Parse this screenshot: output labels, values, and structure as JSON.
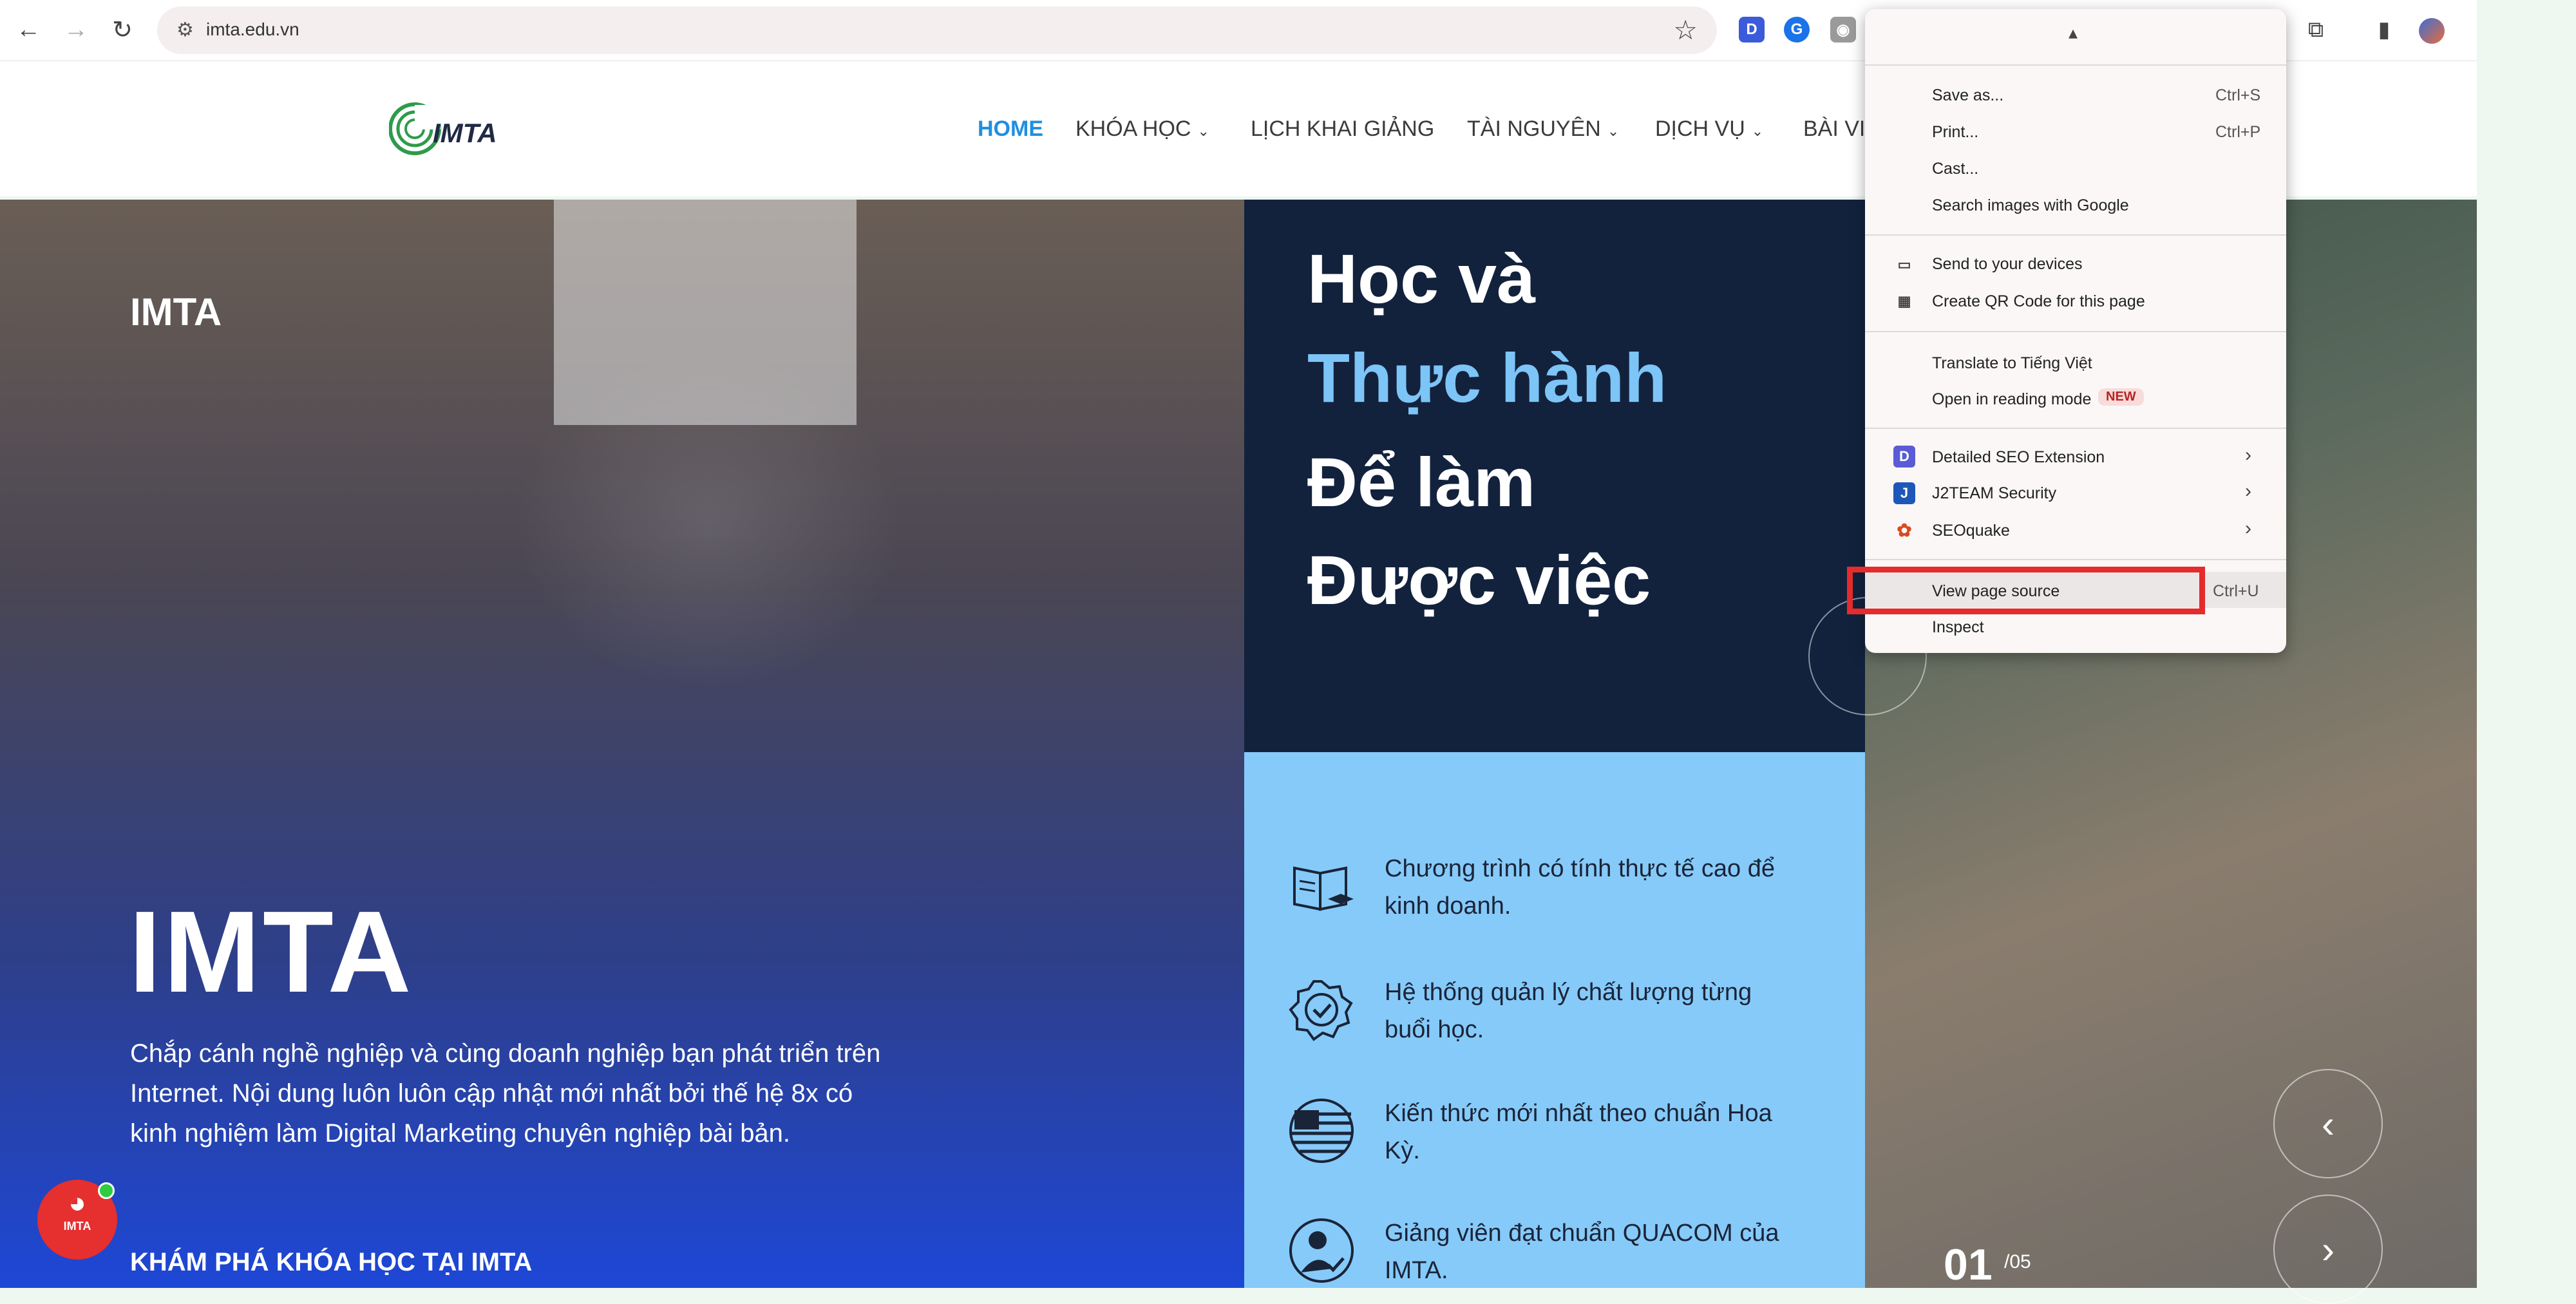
{
  "browser": {
    "url": "imta.edu.vn",
    "extensions": [
      {
        "letter": "D",
        "color": "#3b5bdb"
      },
      {
        "letter": "G",
        "color": "#1a73e8"
      },
      {
        "letter": "",
        "color": "#888888"
      }
    ]
  },
  "site": {
    "logo_text": "IMTA",
    "menu": [
      {
        "label": "HOME",
        "active": true,
        "dropdown": false
      },
      {
        "label": "KHÓA HỌC",
        "active": false,
        "dropdown": true
      },
      {
        "label": "LỊCH KHAI GIẢNG",
        "active": false,
        "dropdown": false
      },
      {
        "label": "TÀI NGUYÊN",
        "active": false,
        "dropdown": true
      },
      {
        "label": "DỊCH VỤ",
        "active": false,
        "dropdown": true
      },
      {
        "label": "BÀI VI",
        "active": false,
        "dropdown": false
      }
    ]
  },
  "hero": {
    "small_title": "IMTA",
    "big_title": "IMTA",
    "description": "Chắp cánh nghề nghiệp và cùng doanh nghiệp bạn phát triển trên Internet. Nội dung luôn luôn cập nhật mới nhất bởi thế hệ 8x có kinh nghiệm làm Digital Marketing chuyên nghiệp bài bản.",
    "cta": "KHÁM PHÁ KHÓA HỌC TẠI IMTA",
    "messenger_label": "IMTA"
  },
  "slogan": {
    "line1": "Học và",
    "line2": "Thực hành",
    "line3": "Để làm",
    "line4": "Được việc"
  },
  "features": [
    {
      "icon": "book-graduation-icon",
      "text": "Chương trình có tính thực tế cao để kinh doanh."
    },
    {
      "icon": "quality-badge-icon",
      "text": "Hệ thống quản lý chất lượng từng buổi học."
    },
    {
      "icon": "us-flag-icon",
      "text": "Kiến thức mới nhất theo chuẩn Hoa Kỳ."
    },
    {
      "icon": "teacher-check-icon",
      "text": "Giảng viên đạt chuẩn QUACOM của IMTA."
    }
  ],
  "slider": {
    "current": "01",
    "total": "/05",
    "prev_glyph": "‹",
    "next_glyph": "›"
  },
  "context_menu": {
    "groups": [
      [
        {
          "label": "Save as...",
          "shortcut": "Ctrl+S"
        },
        {
          "label": "Print...",
          "shortcut": "Ctrl+P"
        },
        {
          "label": "Cast...",
          "shortcut": ""
        },
        {
          "label": "Search images with Google",
          "shortcut": ""
        }
      ],
      [
        {
          "label": "Send to your devices",
          "shortcut": "",
          "icon": "devices-icon"
        },
        {
          "label": "Create QR Code for this page",
          "shortcut": "",
          "icon": "qr-code-icon"
        }
      ],
      [
        {
          "label": "Translate to Tiếng Việt",
          "shortcut": ""
        },
        {
          "label": "Open in reading mode",
          "shortcut": "",
          "badge": "NEW"
        }
      ],
      [
        {
          "label": "Detailed SEO Extension",
          "submenu": true,
          "icon": "detailed-seo-icon"
        },
        {
          "label": "J2TEAM Security",
          "submenu": true,
          "icon": "j2team-icon"
        },
        {
          "label": "SEOquake",
          "submenu": true,
          "icon": "seoquake-icon"
        }
      ],
      [
        {
          "label": "View page source",
          "shortcut": "Ctrl+U",
          "highlighted": true
        },
        {
          "label": "Inspect",
          "shortcut": ""
        }
      ]
    ]
  }
}
